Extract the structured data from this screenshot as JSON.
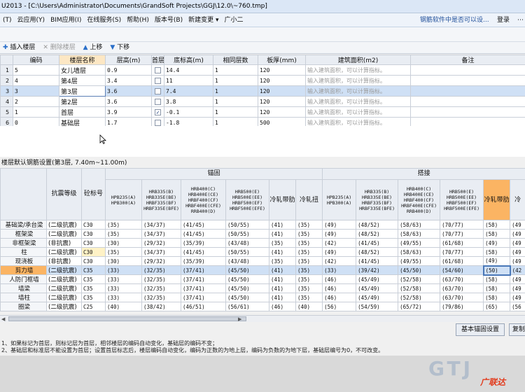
{
  "title": "U2013 - [C:\\Users\\Administrator\\Documents\\GrandSoft Projects\\GGJ\\12.0\\~760.tmp]",
  "menu": [
    "(T)",
    "云应用(Y)",
    "BIM应用(I)",
    "在线服务(S)",
    "帮助(H)",
    "版本号(B)",
    "新建变更 ▾",
    "广小二"
  ],
  "menu_ad": "钢筋软件中是否可以设...",
  "menu_login": "登录",
  "toolbar": {
    "insert": "插入楼层",
    "delete": "删除楼层",
    "up": "上移",
    "down": "下移"
  },
  "floor_table": {
    "headers": [
      "编码",
      "楼层名称",
      "层高(m)",
      "首层",
      "底标高(m)",
      "相同层数",
      "板厚(mm)",
      "建筑面积(m2)",
      "备注"
    ],
    "placeholder": "输入建筑面积，可以计算指标。",
    "rows": [
      {
        "n": "1",
        "code": "5",
        "name": "女儿墙层",
        "h": "0.9",
        "first": false,
        "elev": "14.4",
        "same": "1",
        "thk": "120"
      },
      {
        "n": "2",
        "code": "4",
        "name": "第4层",
        "h": "3.4",
        "first": false,
        "elev": "11",
        "same": "1",
        "thk": "120"
      },
      {
        "n": "3",
        "code": "3",
        "name": "第3层",
        "h": "3.6",
        "first": false,
        "elev": "7.4",
        "same": "1",
        "thk": "120",
        "selected": true
      },
      {
        "n": "4",
        "code": "2",
        "name": "第2层",
        "h": "3.6",
        "first": false,
        "elev": "3.8",
        "same": "1",
        "thk": "120"
      },
      {
        "n": "5",
        "code": "1",
        "name": "首层",
        "h": "3.9",
        "first": true,
        "elev": "-0.1",
        "same": "1",
        "thk": "120"
      },
      {
        "n": "6",
        "code": "0",
        "name": "基础层",
        "h": "1.7",
        "first": false,
        "elev": "-1.8",
        "same": "1",
        "thk": "500"
      }
    ]
  },
  "section_label": "楼层默认钢筋设置(第3层, 7.40m~11.00m)",
  "anchor_table": {
    "group_anchor": "锚固",
    "group_lap": "搭接",
    "col_seismic": "抗震等级",
    "col_concrete": "砼标号",
    "subcols": [
      [
        "HPB235(A)",
        "HPB300(A)"
      ],
      [
        "HRB335(B)",
        "HRB335E(BE)",
        "HRBF335(BF)",
        "HRBF335E(BFE)"
      ],
      [
        "HRB400(C)",
        "HRB400E(CE)",
        "HRBF400(CF)",
        "HRBF400E(CFE)",
        "RRB400(D)"
      ],
      [
        "HRB500(E)",
        "HRB500E(EE)",
        "HRBF500(EF)",
        "HRBF500E(EFE)"
      ],
      [
        "冷轧带肋"
      ],
      [
        "冷轧扭"
      ],
      [
        "HPB235(A)",
        "HPB300(A)"
      ],
      [
        "HRB335(B)",
        "HRB335E(BE)",
        "HRBF335(BF)",
        "HRBF335E(BFE)"
      ],
      [
        "HRB400(C)",
        "HRB400E(CE)",
        "HRBF400(CF)",
        "HRBF400E(CFE)",
        "RRB400(D)"
      ],
      [
        "HRB500(E)",
        "HRB500E(EE)",
        "HRBF500(EF)",
        "HRBF500E(EFE)"
      ],
      [
        "冷轧带肋"
      ],
      [
        "冷"
      ]
    ],
    "rows": [
      {
        "comp": "基础梁/承台梁",
        "seis": "(二级抗震)",
        "conc": "C30",
        "v": [
          "(35)",
          "(34/37)",
          "(41/45)",
          "(50/55)",
          "(41)",
          "(35)",
          "(49)",
          "(48/52)",
          "(58/63)",
          "(70/77)",
          "(58)",
          "(49"
        ]
      },
      {
        "comp": "框架梁",
        "seis": "(二级抗震)",
        "conc": "C30",
        "v": [
          "(35)",
          "(34/37)",
          "(41/45)",
          "(50/55)",
          "(41)",
          "(35)",
          "(49)",
          "(48/52)",
          "(58/63)",
          "(70/77)",
          "(58)",
          "(49"
        ]
      },
      {
        "comp": "非框架梁",
        "seis": "(非抗震)",
        "conc": "C30",
        "v": [
          "(30)",
          "(29/32)",
          "(35/39)",
          "(43/48)",
          "(35)",
          "(35)",
          "(42)",
          "(41/45)",
          "(49/55)",
          "(61/68)",
          "(49)",
          "(49"
        ]
      },
      {
        "comp": "柱",
        "seis": "(二级抗震)",
        "conc": "C30",
        "concHL": true,
        "v": [
          "(35)",
          "(34/37)",
          "(41/45)",
          "(50/55)",
          "(41)",
          "(35)",
          "(49)",
          "(48/52)",
          "(58/63)",
          "(70/77)",
          "(58)",
          "(49"
        ]
      },
      {
        "comp": "现浇板",
        "seis": "(非抗震)",
        "conc": "C30",
        "v": [
          "(30)",
          "(29/32)",
          "(35/39)",
          "(43/48)",
          "(35)",
          "(35)",
          "(42)",
          "(41/45)",
          "(49/55)",
          "(61/68)",
          "(49)",
          "(49"
        ]
      },
      {
        "comp": "剪力墙",
        "seis": "(二级抗震)",
        "conc": "C35",
        "selected": true,
        "v": [
          "(33)",
          "(32/35)",
          "(37/41)",
          "(45/50)",
          "(41)",
          "(35)",
          "(33)",
          "(39/42)",
          "(45/50)",
          "(54/60)",
          "(50)",
          "(42"
        ]
      },
      {
        "comp": "人防门框墙",
        "seis": "(二级抗震)",
        "conc": "C35",
        "v": [
          "(33)",
          "(32/35)",
          "(37/41)",
          "(45/50)",
          "(41)",
          "(35)",
          "(46)",
          "(45/49)",
          "(52/58)",
          "(63/70)",
          "(58)",
          "(49"
        ]
      },
      {
        "comp": "墙梁",
        "seis": "(二级抗震)",
        "conc": "C35",
        "v": [
          "(33)",
          "(32/35)",
          "(37/41)",
          "(45/50)",
          "(41)",
          "(35)",
          "(46)",
          "(45/49)",
          "(52/58)",
          "(63/70)",
          "(58)",
          "(49"
        ]
      },
      {
        "comp": "墙柱",
        "seis": "(二级抗震)",
        "conc": "C35",
        "v": [
          "(33)",
          "(32/35)",
          "(37/41)",
          "(45/50)",
          "(41)",
          "(35)",
          "(46)",
          "(45/49)",
          "(52/58)",
          "(63/70)",
          "(58)",
          "(49"
        ]
      },
      {
        "comp": "圈梁",
        "seis": "(二级抗震)",
        "conc": "C25",
        "v": [
          "(40)",
          "(38/42)",
          "(46/51)",
          "(56/61)",
          "(46)",
          "(40)",
          "(56)",
          "(54/59)",
          "(65/72)",
          "(79/86)",
          "(65)",
          "(56"
        ]
      }
    ]
  },
  "buttons": {
    "base_anchor": "基本锚固设置",
    "copy": "复制"
  },
  "notes": [
    "1、如果标记为首层，则标记层为首层，相邻楼层的编码自动变化，基础层的编码不变；",
    "2、基础层和标准层不能设置为首层；设置首层标志后，楼层编码自动变化，编码为正数的为地上层，编码为负数的为地下层，基础层编号为0，不可改变。"
  ],
  "watermark": "GTJ",
  "brand": "广联达"
}
